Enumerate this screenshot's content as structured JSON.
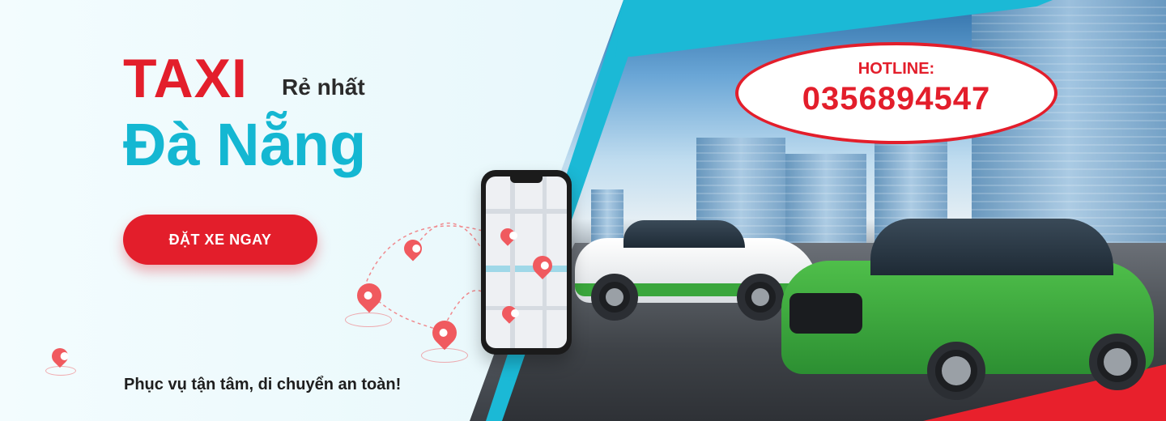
{
  "hero": {
    "title_main": "TAXI",
    "title_suffix": "Rẻ nhất",
    "title_city": "Đà Nẵng",
    "cta_label": "ĐẶT XE NGAY",
    "slogan": "Phục vụ tận tâm, di chuyển an toàn!"
  },
  "hotline": {
    "label": "HOTLINE:",
    "number": "0356894547"
  },
  "colors": {
    "brand_red": "#e31e2b",
    "brand_cyan": "#14b7d2",
    "taxi_green": "#3aa63c"
  },
  "icons": [
    "location-pin-icon",
    "alert-pin-icon",
    "smartphone-map-icon"
  ]
}
